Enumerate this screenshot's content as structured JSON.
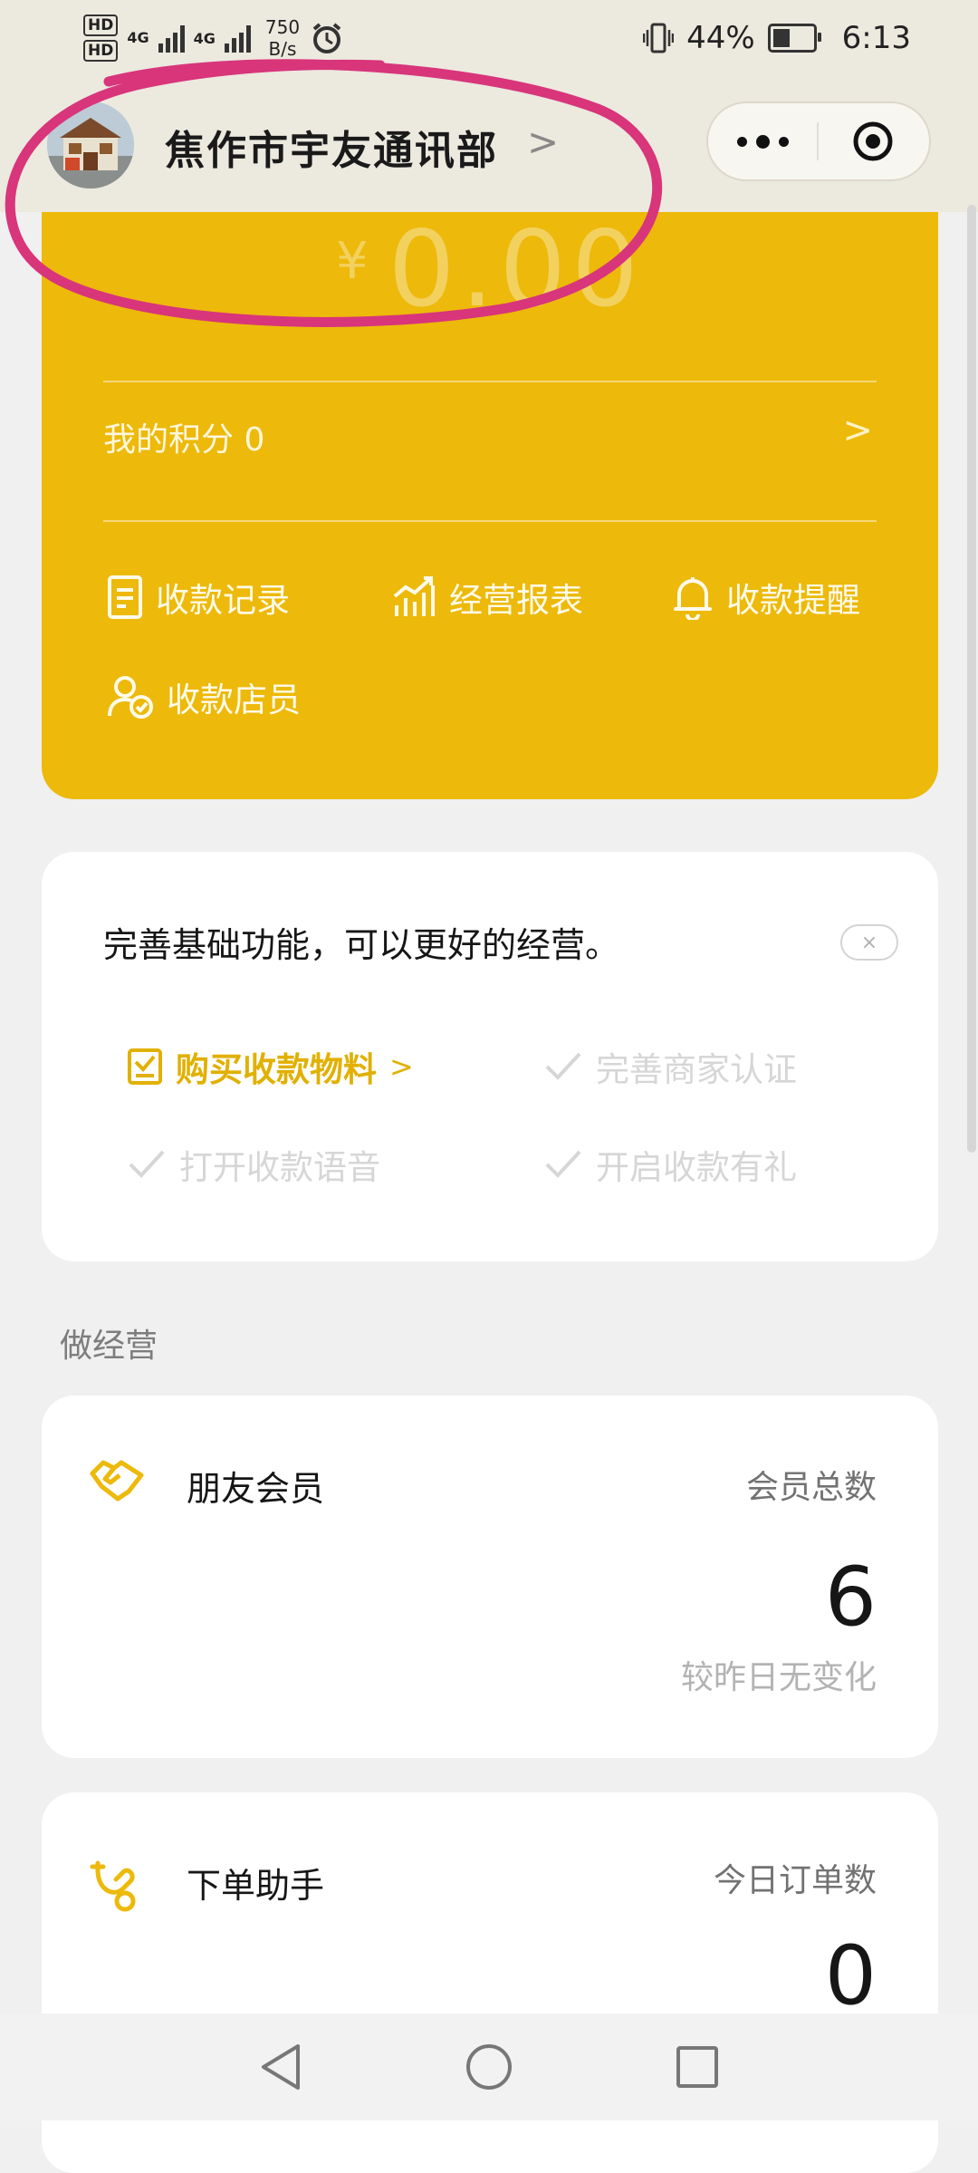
{
  "status_bar": {
    "sim1": "HD",
    "sim2": "HD",
    "net1": "4G",
    "net2": "4G",
    "speed_value": "750",
    "speed_unit": "B/s",
    "battery_text": "44%",
    "battery_level": 0.44,
    "time": "6:13"
  },
  "header": {
    "store_name": "焦作市宇友通讯部",
    "chevron": ">"
  },
  "wallet": {
    "currency": "¥",
    "balance": "0.00",
    "points_label": "我的积分 0",
    "chevron": ">"
  },
  "quick_actions": [
    {
      "label": "收款记录",
      "icon": "receipt-icon"
    },
    {
      "label": "经营报表",
      "icon": "chart-icon"
    },
    {
      "label": "收款提醒",
      "icon": "bell-icon"
    },
    {
      "label": "收款店员",
      "icon": "staff-icon"
    }
  ],
  "setup_card": {
    "title": "完善基础功能，可以更好的经营。",
    "close": "×",
    "tasks": [
      {
        "label": "购买收款物料",
        "suffix": ">",
        "state": "active"
      },
      {
        "label": "完善商家认证",
        "state": "done"
      },
      {
        "label": "打开收款语音",
        "state": "done"
      },
      {
        "label": "开启收款有礼",
        "state": "done"
      }
    ]
  },
  "section_title": "做经营",
  "member_card": {
    "title": "朋友会员",
    "metric_label": "会员总数",
    "metric_value": "6",
    "metric_sub": "较昨日无变化"
  },
  "order_card": {
    "title": "下单助手",
    "metric_label": "今日订单数",
    "metric_value": "0"
  },
  "colors": {
    "accent": "#edb90a",
    "annotation": "#d8357b"
  }
}
